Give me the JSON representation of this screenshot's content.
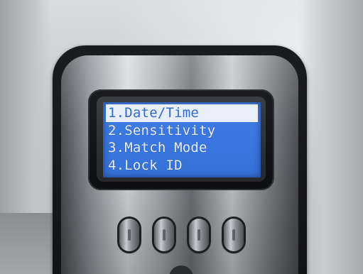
{
  "device": {
    "menu": {
      "items": [
        {
          "label": "1.Date/Time",
          "selected": true
        },
        {
          "label": "2.Sensitivity",
          "selected": false
        },
        {
          "label": "3.Match Mode",
          "selected": false
        },
        {
          "label": "4.Lock ID",
          "selected": false
        }
      ]
    },
    "buttons": [
      {
        "icon": "button-blank-icon"
      },
      {
        "icon": "button-blank-icon"
      },
      {
        "icon": "button-blank-icon"
      },
      {
        "icon": "button-blank-icon"
      }
    ],
    "colors": {
      "lcd_background": "#3a77e0",
      "lcd_text": "#e9f0ff",
      "selection_background": "#e8effb",
      "selection_text": "#2f6ad4",
      "housing": "#1b1c1e"
    }
  }
}
